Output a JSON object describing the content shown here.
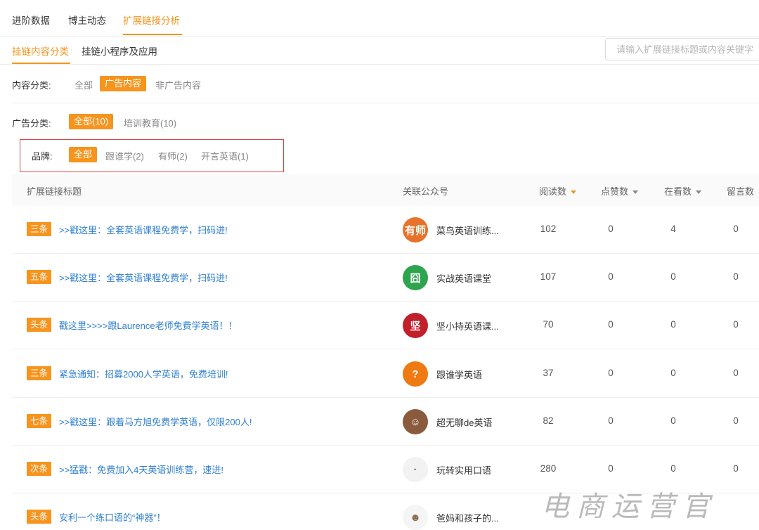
{
  "top_tabs": [
    {
      "label": "进阶数据"
    },
    {
      "label": "博主动态"
    },
    {
      "label": "扩展链接分析"
    }
  ],
  "sub_tabs": [
    {
      "label": "挂链内容分类"
    },
    {
      "label": "挂链小程序及应用"
    }
  ],
  "search": {
    "placeholder": "请输入扩展链接标题或内容关键字"
  },
  "content_filter": {
    "label": "内容分类:",
    "options": [
      "全部",
      "广告内容",
      "非广告内容"
    ],
    "selected": "广告内容"
  },
  "ad_filter": {
    "label": "广告分类:",
    "options": [
      "全部(10)",
      "培训教育(10)"
    ],
    "selected": "全部(10)"
  },
  "brand_filter": {
    "label": "品牌:",
    "options": [
      "全部",
      "跟谁学(2)",
      "有师(2)",
      "开言英语(1)"
    ],
    "selected": "全部"
  },
  "table": {
    "headers": [
      "扩展链接标题",
      "关联公众号",
      "阅读数",
      "点赞数",
      "在看数",
      "留言数"
    ],
    "rows": [
      {
        "badge": "三条",
        "title": ">>戳这里：全套英语课程免费学，扫码进!",
        "account": "菜鸟英语训练...",
        "avatar_text": "有师",
        "avatar_color": "#e8722a",
        "reads": "102",
        "likes": "0",
        "watching": "4",
        "comments": "0"
      },
      {
        "badge": "五条",
        "title": ">>戳这里：全套英语课程免费学，扫码进!",
        "account": "实战英语课堂",
        "avatar_text": "囧",
        "avatar_color": "#2ea44f",
        "reads": "107",
        "likes": "0",
        "watching": "0",
        "comments": "0"
      },
      {
        "badge": "头条",
        "title": "戳这里>>>>跟Laurence老师免费学英语！！",
        "account": "坚小持英语课...",
        "avatar_text": "坚",
        "avatar_color": "#c0202a",
        "reads": "70",
        "likes": "0",
        "watching": "0",
        "comments": "0"
      },
      {
        "badge": "三条",
        "title": "紧急通知：招募2000人学英语，免费培训!",
        "account": "跟谁学英语",
        "avatar_text": "?",
        "avatar_color": "#f07a12",
        "reads": "37",
        "likes": "0",
        "watching": "0",
        "comments": "0"
      },
      {
        "badge": "七条",
        "title": ">>戳这里：跟着马方旭免费学英语，仅限200人!",
        "account": "超无聊de英语",
        "avatar_text": "☺",
        "avatar_color": "#8a5a3c",
        "reads": "82",
        "likes": "0",
        "watching": "0",
        "comments": "0"
      },
      {
        "badge": "次条",
        "title": ">>猛戳：免费加入4天英语训练营，速进!",
        "account": "玩转实用口语",
        "avatar_text": "·",
        "avatar_color": "#f2f2f2",
        "reads": "280",
        "likes": "0",
        "watching": "0",
        "comments": "0"
      },
      {
        "badge": "头条",
        "title": "安利一个练口语的“神器”！",
        "account": "爸妈和孩子的...",
        "avatar_text": "☻",
        "avatar_color": "#f5f5f5",
        "reads": "",
        "likes": "",
        "watching": "",
        "comments": ""
      }
    ]
  },
  "watermark": "电商运营官",
  "colors": {
    "accent": "#f7941d",
    "link": "#2f7fd1",
    "highlight_box": "#d94545"
  }
}
